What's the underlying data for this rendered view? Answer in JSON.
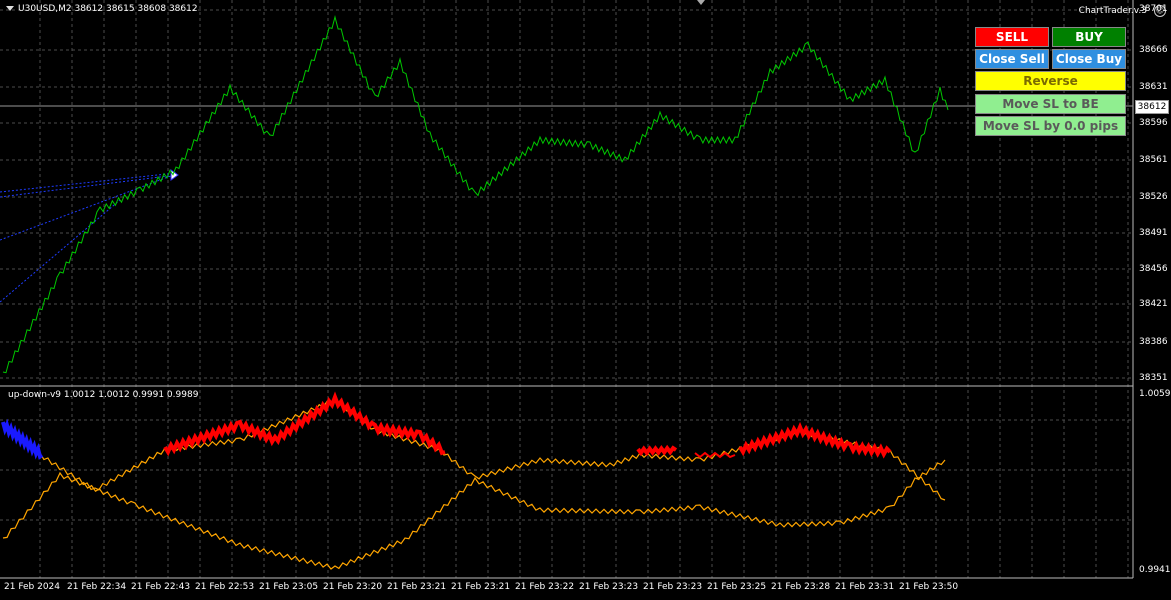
{
  "header": {
    "symbol_line": "U30USD,M2  38612 38615 38608 38612",
    "brand": "ChartTrader.v.3"
  },
  "indicator": {
    "label": "up-down-v9 1.0012 1.0012 0.9991 0.9989"
  },
  "buttons": {
    "sell": "SELL",
    "buy": "BUY",
    "close_sell": "Close Sell",
    "close_buy": "Close Buy",
    "reverse": "Reverse",
    "move_sl_be": "Move SL to BE",
    "move_sl_pips": "Move SL by 0.0 pips"
  },
  "price_axis": [
    "38701",
    "38666",
    "38631",
    "38596",
    "38561",
    "38526",
    "38491",
    "38456",
    "38421",
    "38386",
    "38351"
  ],
  "current_price": "38612",
  "indicator_axis": {
    "max": "1.0059",
    "min": "0.9941"
  },
  "time_axis": [
    "21 Feb 2024",
    "21 Feb 22:34",
    "21 Feb 22:43",
    "21 Feb 22:53",
    "21 Feb 23:05",
    "21 Feb 23:20",
    "21 Feb 23:21",
    "21 Feb 23:21",
    "21 Feb 23:22",
    "21 Feb 23:23",
    "21 Feb 23:23",
    "21 Feb 23:25",
    "21 Feb 23:28",
    "21 Feb 23:31",
    "21 Feb 23:50"
  ],
  "colors": {
    "background": "#000000",
    "grid": "#4d4d4d",
    "price_line": "#00c800",
    "indicator_line": "#ffa500",
    "signal_red": "#ff0000",
    "signal_blue": "#1a1aff"
  }
}
